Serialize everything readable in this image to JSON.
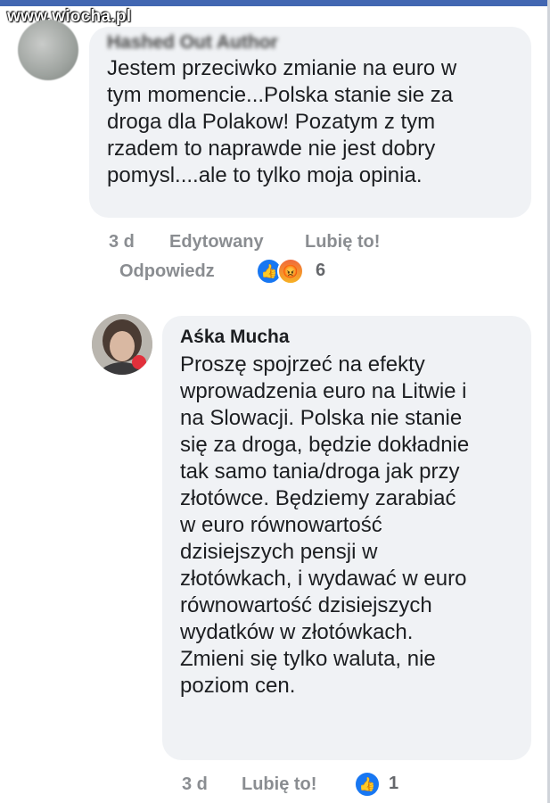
{
  "watermark": "www.wiocha.pl",
  "comments": [
    {
      "author": "Hashed Out Author",
      "text": "Jestem przeciwko zmianie na euro w\ntym momencie...Polska stanie sie za\ndroga dla Polakow! Pozatym z tym\nrzadem to naprawde nie jest dobry\npomysl....ale to tylko moja opinia.",
      "time": "3 d",
      "edited": "Edytowany",
      "like_label": "Lubię to!",
      "reply_label": "Odpowiedz",
      "reaction_count": "6",
      "reactions": [
        "like-icon",
        "angry-icon"
      ]
    },
    {
      "author": "Aśka Mucha",
      "text": "Proszę spojrzeć na efekty\nwprowadzenia euro na Litwie i\nna Slowacji. Polska nie stanie\nsię za droga, będzie dokładnie\ntak samo tania/droga jak przy\nzłotówce. Będziemy zarabiać\nw euro równowartość\ndzisiejszych pensji w\nzłotówkach, i wydawać w euro\nrównowartość dzisiejszych\nwydatków w złotówkach.\nZmieni się tylko waluta, nie\npoziom cen.",
      "time": "3 d",
      "like_label": "Lubię to!",
      "reaction_count": "1",
      "reactions": [
        "like-icon"
      ]
    }
  ],
  "colors": {
    "brand": "#4267b2",
    "bubble": "#f0f2f5",
    "meta": "#8a8d91",
    "like": "#1877f2"
  }
}
